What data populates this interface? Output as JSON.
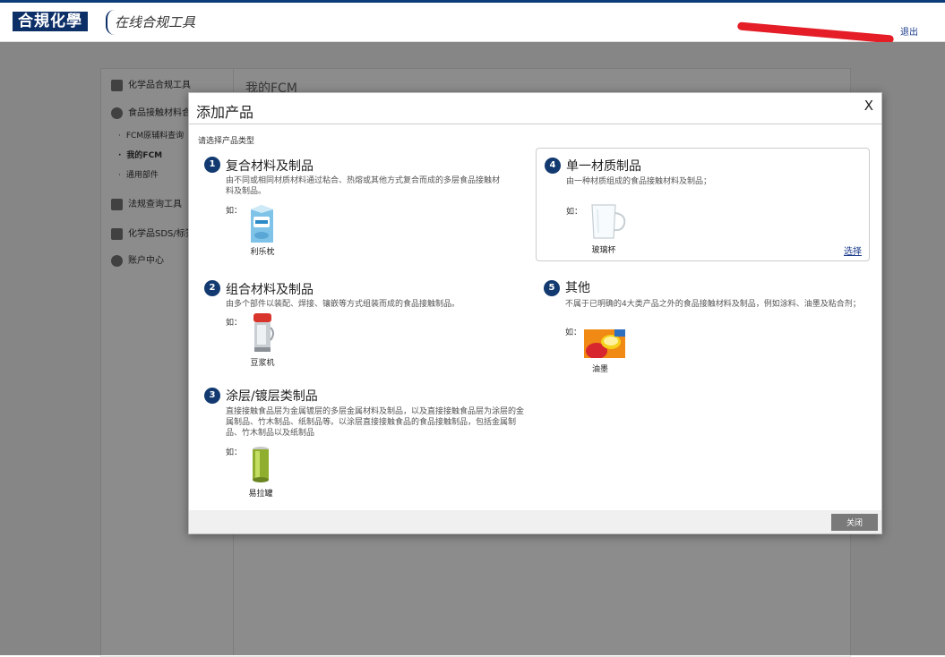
{
  "header": {
    "logo_text": "合規化學",
    "logo_subtitle": "在线合规工具",
    "logout_label": "退出"
  },
  "sidebar": {
    "items": [
      {
        "label": "化学品合规工具",
        "icon": "grid-icon"
      },
      {
        "label": "食品接触材料合规",
        "icon": "user-icon"
      },
      {
        "label": "法规查询工具",
        "icon": "document-icon"
      },
      {
        "label": "化学品SDS/标签",
        "icon": "tag-icon"
      },
      {
        "label": "账户中心",
        "icon": "account-icon"
      }
    ],
    "sub_items": [
      {
        "label": "FCM原辅料查询"
      },
      {
        "label": "我的FCM"
      },
      {
        "label": "通用部件"
      }
    ]
  },
  "background": {
    "page_title": "我的FCM"
  },
  "modal": {
    "title": "添加产品",
    "close_x": "X",
    "hint": "请选择产品类型",
    "ru_label": "如：",
    "select_label": "选择",
    "close_label": "关闭",
    "types": [
      {
        "num": "1",
        "title": "复合材料及制品",
        "desc": "由不同或相同材质材料通过粘合、热熔或其他方式复合而成的多层食品接触材料及制品。",
        "example": "利乐枕",
        "icon": "milk-carton-icon"
      },
      {
        "num": "2",
        "title": "组合材料及制品",
        "desc": "由多个部件以装配、焊接、镶嵌等方式组装而成的食品接触制品。",
        "example": "豆浆机",
        "icon": "soymilk-maker-icon"
      },
      {
        "num": "3",
        "title": "涂层/镀层类制品",
        "desc": "直接接触食品层为金属镀层的多层金属材料及制品，以及直接接触食品层为涂层的金属制品、竹木制品、纸制品等。以涂层直接接触食品的食品接触制品，包括金属制品、竹木制品以及纸制品",
        "example": "易拉罐",
        "icon": "can-icon"
      },
      {
        "num": "4",
        "title": "单一材质制品",
        "desc": "由一种材质组成的食品接触材料及制品；",
        "example": "玻璃杯",
        "icon": "glass-cup-icon"
      },
      {
        "num": "5",
        "title": "其他",
        "desc": "不属于已明确的4大类产品之外的食品接触材料及制品，例如涂料、油墨及粘合剂；",
        "example": "油墨",
        "icon": "ink-icon"
      }
    ]
  },
  "colors": {
    "brand_navy": "#123a70",
    "overlay": "#000000",
    "close_button": "#7a7a7a",
    "link": "#1a3a8a"
  }
}
